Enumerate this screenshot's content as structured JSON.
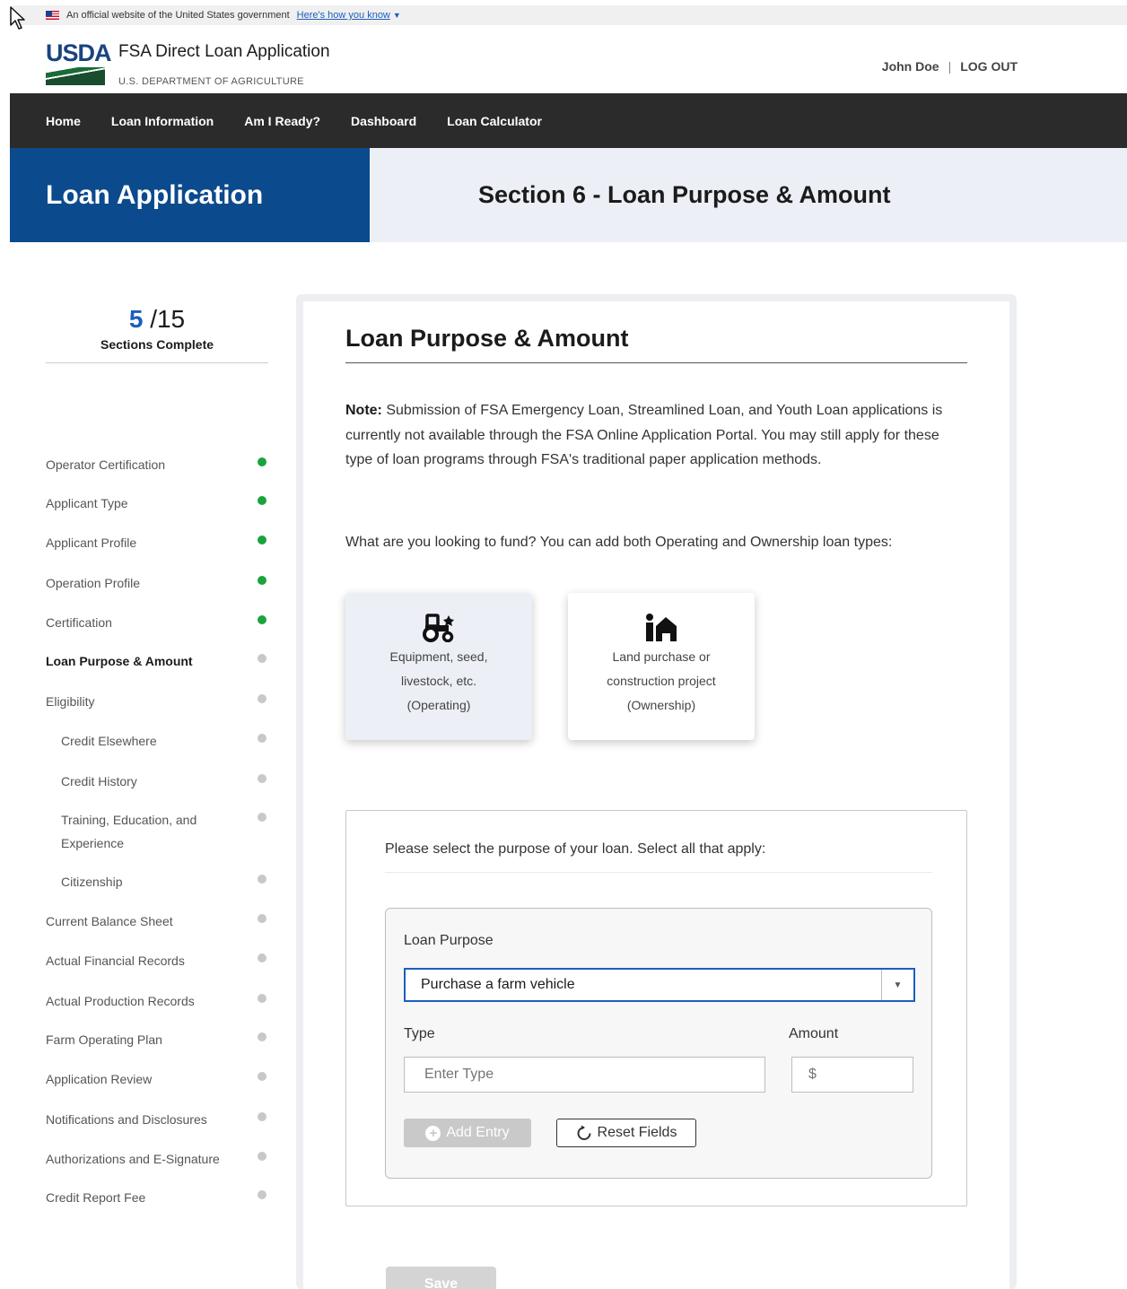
{
  "gov_banner": {
    "text": "An official website of the United States government",
    "link": "Here's how you know"
  },
  "header": {
    "logo_text": "USDA",
    "app_title": "FSA Direct Loan Application",
    "department": "U.S. DEPARTMENT OF AGRICULTURE",
    "user_name": "John Doe",
    "separator": "|",
    "logout": "LOG OUT"
  },
  "nav": {
    "items": [
      {
        "label": "Home"
      },
      {
        "label": "Loan Information"
      },
      {
        "label": "Am I Ready?"
      },
      {
        "label": "Dashboard"
      },
      {
        "label": "Loan Calculator"
      }
    ]
  },
  "hero": {
    "left_title": "Loan Application",
    "section_title": "Section 6 - Loan Purpose & Amount"
  },
  "sidebar": {
    "progress": {
      "done": "5",
      "total": "/15",
      "label": "Sections Complete"
    },
    "items": [
      {
        "label": "Operator Certification",
        "status": "complete"
      },
      {
        "label": "Applicant Type",
        "status": "complete"
      },
      {
        "label": "Applicant Profile",
        "status": "complete"
      },
      {
        "label": "Operation Profile",
        "status": "complete"
      },
      {
        "label": "Certification",
        "status": "complete"
      },
      {
        "label": "Loan Purpose & Amount",
        "status": "current"
      },
      {
        "label": "Eligibility",
        "status": "incomplete"
      },
      {
        "label": "Credit Elsewhere",
        "status": "incomplete"
      },
      {
        "label": "Credit History",
        "status": "incomplete"
      },
      {
        "label": "Training, Education, and Experience",
        "status": "incomplete"
      },
      {
        "label": "Citizenship",
        "status": "incomplete"
      },
      {
        "label": "Current Balance Sheet",
        "status": "incomplete"
      },
      {
        "label": "Actual Financial Records",
        "status": "incomplete"
      },
      {
        "label": "Actual Production Records",
        "status": "incomplete"
      },
      {
        "label": "Farm Operating Plan",
        "status": "incomplete"
      },
      {
        "label": "Application Review",
        "status": "incomplete"
      },
      {
        "label": "Notifications and Disclosures",
        "status": "incomplete"
      },
      {
        "label": "Authorizations and E-Signature",
        "status": "incomplete"
      },
      {
        "label": "Credit Report Fee",
        "status": "incomplete"
      }
    ]
  },
  "main": {
    "title": "Loan Purpose & Amount",
    "note_label": "Note:",
    "note_text": " Submission of FSA Emergency Loan, Streamlined Loan, and Youth Loan applications is currently not available through the FSA Online Application Portal. You may still apply for these type of loan programs through FSA's traditional paper application methods.",
    "question": "What are you looking to fund? You can add both Operating and Ownership loan types:",
    "tiles": [
      {
        "line1": "Equipment, seed,",
        "line2": "livestock, etc.",
        "line3": "(Operating)",
        "icon": "tractor-icon",
        "selected": true
      },
      {
        "line1": "Land purchase or",
        "line2": "construction project",
        "line3": "(Ownership)",
        "icon": "land-ownership-icon",
        "selected": false
      }
    ],
    "purpose_question": "Please select the purpose of your loan. Select all that apply:",
    "form": {
      "loan_purpose_label": "Loan Purpose",
      "loan_purpose_value": "Purchase a farm vehicle",
      "type_label": "Type",
      "type_placeholder": "Enter Type",
      "amount_label": "Amount",
      "amount_placeholder": "$",
      "add_button": "Add Entry",
      "reset_button": "Reset Fields"
    },
    "save_button": "Save"
  },
  "colors": {
    "hero_blue": "#0b4a8c",
    "complete_green": "#1aa43d",
    "link_blue": "#1a5fbf",
    "nav_dark": "#2b2b2b"
  }
}
